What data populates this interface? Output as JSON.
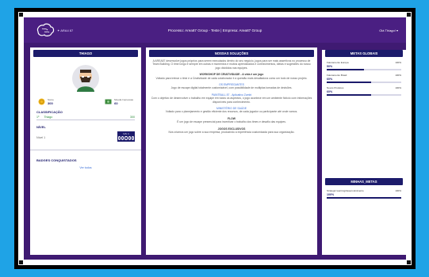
{
  "header": {
    "logo_text": "✦ ARA4 87",
    "title": "Processo: Area87 Group - Teste | Empresa: Area87 Group",
    "user_menu": "Olá Thiago! ▾"
  },
  "profile": {
    "name": "THIAGO",
    "stats": [
      {
        "label": "Score",
        "value": "300"
      },
      {
        "label": "Moeda Impressas",
        "value": "60"
      }
    ],
    "classificacao_label": "CLASSIFICAÇÃO",
    "classificacao": {
      "position": "1º",
      "name": "Thiago",
      "score": "300"
    },
    "nivel_label": "NÍVEL",
    "nivel_text": "Nível 1",
    "level_box_label": "LVL 1",
    "badges_label": "BADGES CONQUISTADOS",
    "badges_link": "Ver todos"
  },
  "solutions": {
    "title": "NOSSAS SOLUÇÕES",
    "intro": "A AREA87 desenvolve jogos próprios para serem executados dentro do seu negócio, jogos para ser mais assertivos no processo de Team Building. O time longo é sempre em outras e momentos e muitos aprendizados e conhecimentos, ideias e sugestões do nosso jogo divididos nas equipes.",
    "sections": [
      {
        "heading": "WORKSHOP DE CRIATIVIDADE - A vida é um jogo",
        "text": "Voltado para treinar o time e a Criatividade de cada colaborador é a questão mais desafiadora como um todo de nosso projeto."
      },
      {
        "heading": "OS EMPREGANTES",
        "text": "Jogo de escape digital totalmente customizável, com possibilidade de multiplas tomadas de decisões."
      },
      {
        "heading": "PAINTBALL 87 - Aplicativo Zumbi",
        "text": "Com o objetivo de desenvolver o trabalho em equipe em todos os aspectos, o jogo acontece em um ambiente fictício com informações disponíveis para conhecimento."
      },
      {
        "heading": "MINISTÉRIO DE SAÚDE",
        "text": "Voltado para o planejamento e gestão eficiente dos recursos, de cada jogador ou participante até onde vamos."
      },
      {
        "heading": "FLOW",
        "text": "É um jogo de escape presencial para incentivar o trabalho dos times e desafio das equipes."
      },
      {
        "heading": "JOGOS EXCLUSIVOS",
        "text": "Nós criamos um jogo sobre a sua empresa, produzindo a experiência customizada para sua organização."
      }
    ]
  },
  "metas_globais": {
    "title": "METAS GLOBAIS",
    "items": [
      {
        "name": "Faturamento Europa",
        "target": "100%",
        "pct": "50%",
        "value": 0.5
      },
      {
        "name": "Faturamento Brasil",
        "target": "100%",
        "pct": "60%",
        "value": 0.6
      },
      {
        "name": "Novos Produtos",
        "target": "100%",
        "pct": "60%",
        "value": 0.6
      }
    ]
  },
  "minhas_metas": {
    "title": "MINHAS_METAS",
    "items": [
      {
        "name": "Strategic learning/desenvolvimento",
        "target": "100%",
        "pct": "100%",
        "value": 1.0
      }
    ]
  }
}
